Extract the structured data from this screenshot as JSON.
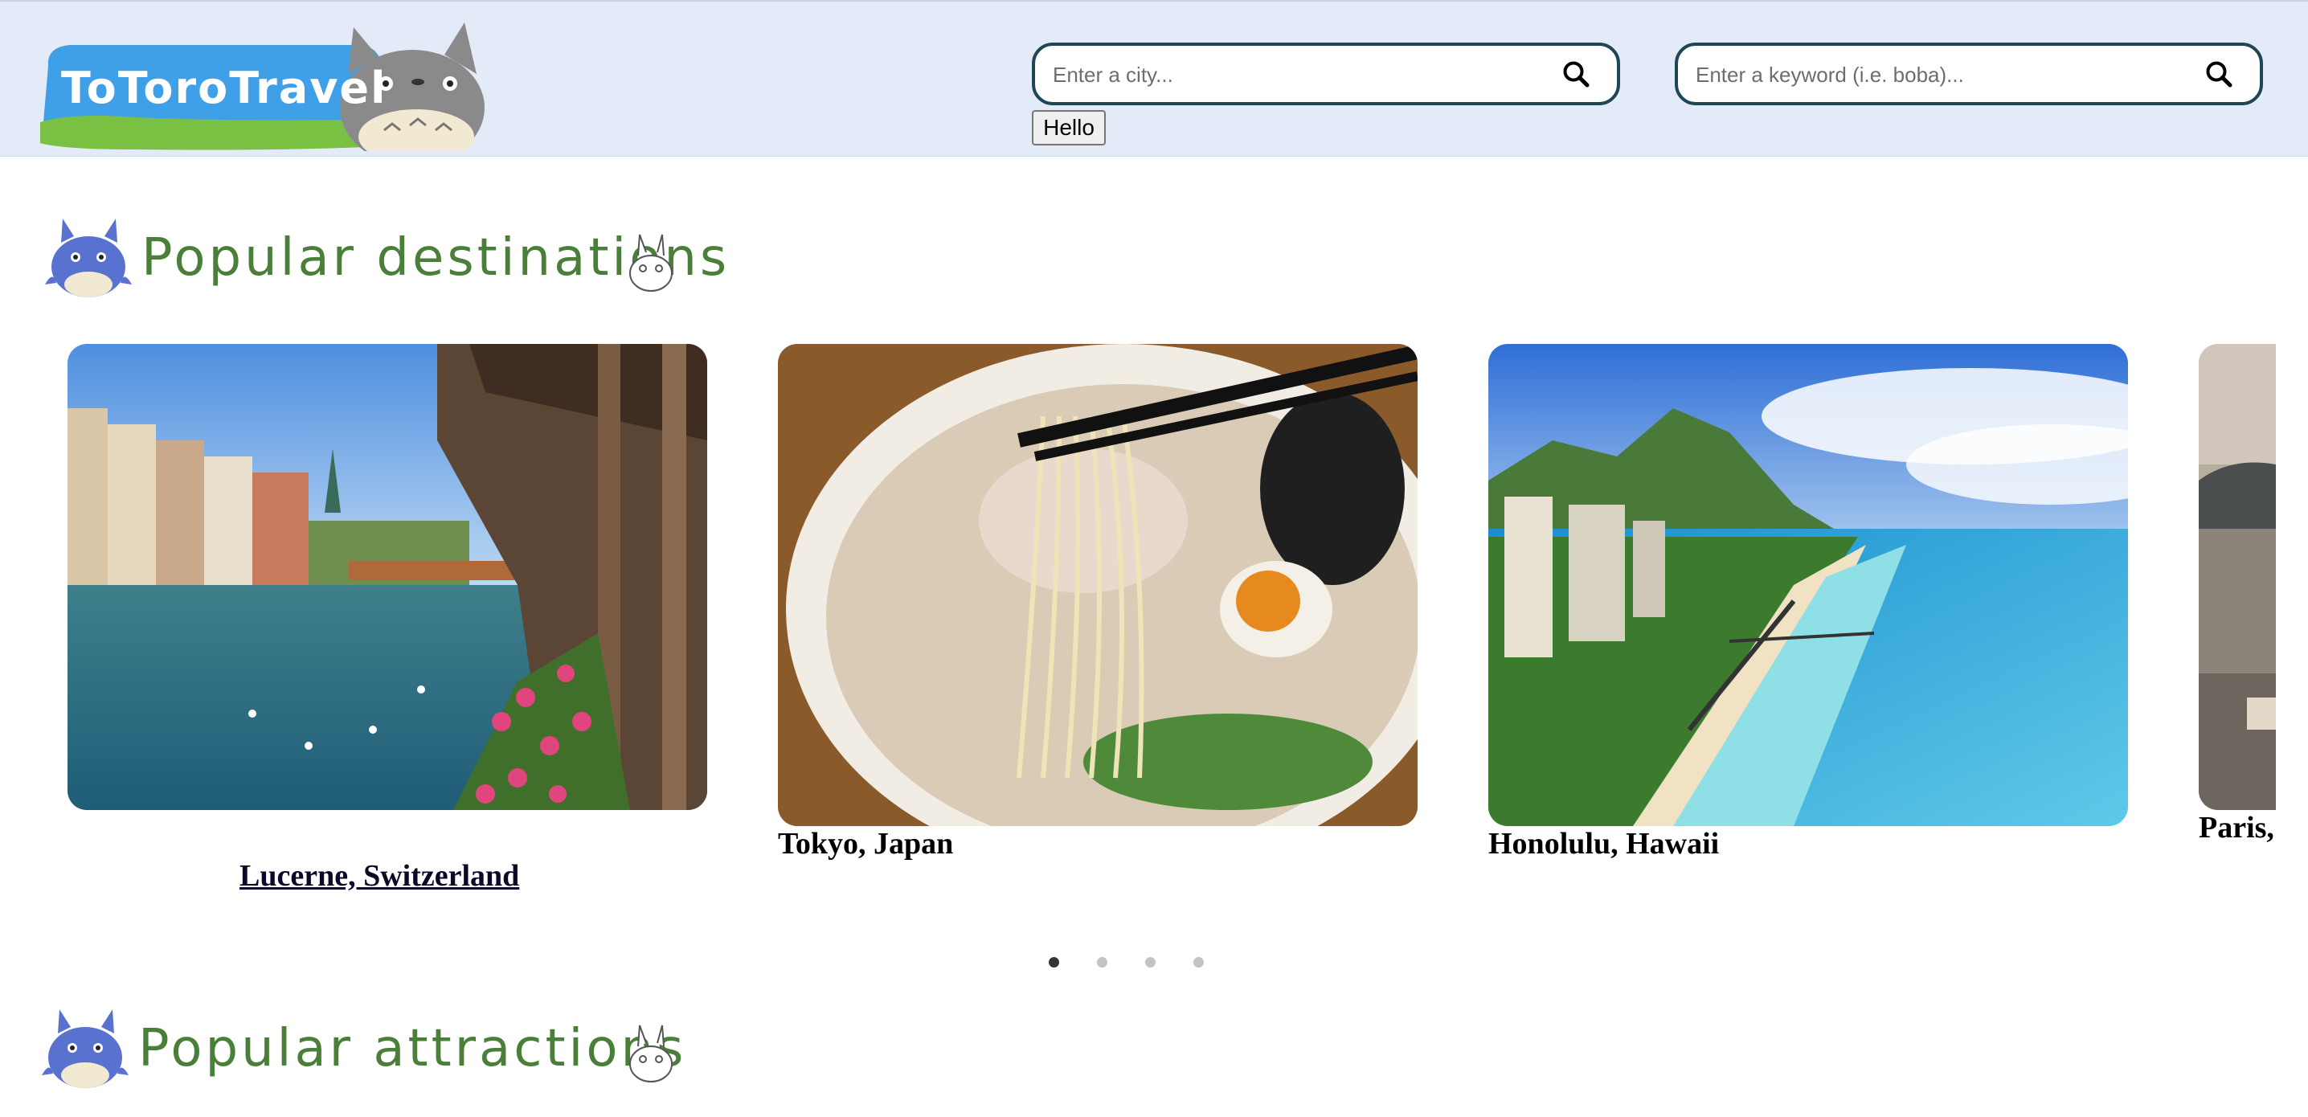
{
  "header": {
    "logo_text": "ToToroTravel",
    "city_search": {
      "placeholder": "Enter a city...",
      "value": ""
    },
    "keyword_search": {
      "placeholder": "Enter a keyword (i.e. boba)...",
      "value": ""
    },
    "hello_button": "Hello"
  },
  "sections": {
    "destinations_title": "Popular destinations",
    "attractions_title": "Popular attractions"
  },
  "destinations": [
    {
      "label": "Lucerne, Switzerland"
    },
    {
      "label": "Tokyo, Japan"
    },
    {
      "label": "Honolulu, Hawaii"
    },
    {
      "label": "Paris,"
    }
  ],
  "carousel": {
    "total_dots": 4,
    "active_dot": 1
  },
  "colors": {
    "header_bg": "#e3ebf9",
    "search_border": "#1f4654",
    "title_green": "#4a7f3a",
    "totoro_blue": "#5a72cf",
    "totoro_gray": "#8a8a8a"
  }
}
